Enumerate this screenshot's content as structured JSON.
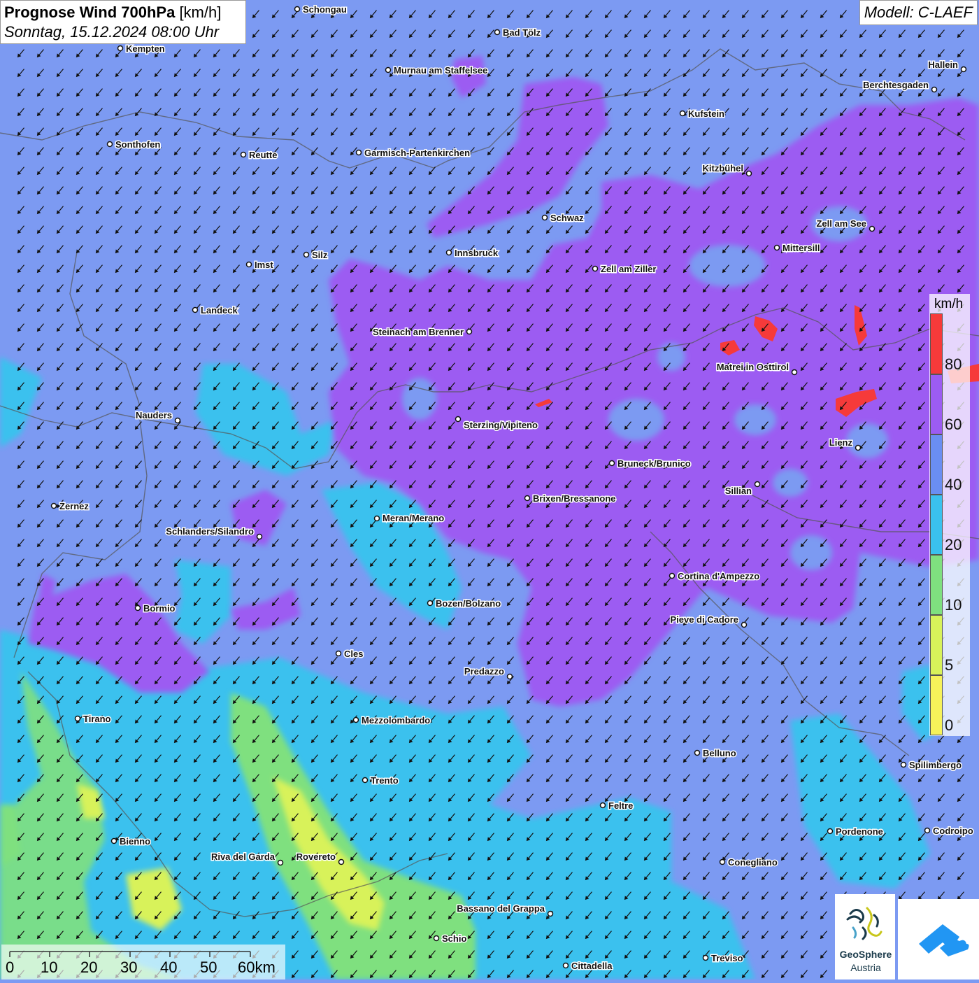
{
  "title": {
    "bold": "Prognose Wind 700hPa",
    "unit": "[km/h]",
    "date": "Sonntag, 15.12.2024 08:00 Uhr"
  },
  "model": "Modell: C-LAEF",
  "legend": {
    "unit": "km/h",
    "labels": [
      "80",
      "60",
      "40",
      "20",
      "10",
      "5",
      "0"
    ],
    "colors": {
      "80+": "#f63a3a",
      "60-80": "#9c5cf2",
      "40-60": "#6a8ef2",
      "20-40": "#3ac1ee",
      "10-20": "#7fe07f",
      "5-10": "#d8f25a",
      "0-5": "#f6f25a"
    }
  },
  "scale": {
    "labels": [
      "0",
      "10",
      "20",
      "30",
      "40",
      "50",
      "60km"
    ]
  },
  "logo": {
    "name": "GeoSphere",
    "sub": "Austria",
    "icon": "geosphere-logo-icon",
    "icon2": "cloud-arrow-icon"
  },
  "wind_direction": "north-west to south-east arrows",
  "cities": [
    {
      "name": "Schongau"
    },
    {
      "name": "Bad Tölz"
    },
    {
      "name": "Kempten"
    },
    {
      "name": "Murnau am Staffelsee"
    },
    {
      "name": "Hallein"
    },
    {
      "name": "Berchtesgaden"
    },
    {
      "name": "Kufstein"
    },
    {
      "name": "Sonthofen"
    },
    {
      "name": "Reutte"
    },
    {
      "name": "Garmisch-Partenkirchen"
    },
    {
      "name": "Kitzbühel"
    },
    {
      "name": "Schwaz"
    },
    {
      "name": "Zell am See"
    },
    {
      "name": "Innsbruck"
    },
    {
      "name": "Mittersill"
    },
    {
      "name": "Silz"
    },
    {
      "name": "Imst"
    },
    {
      "name": "Zell am Ziller"
    },
    {
      "name": "Landeck"
    },
    {
      "name": "Steinach am Brenner"
    },
    {
      "name": "Matrei in Osttirol"
    },
    {
      "name": "Nauders"
    },
    {
      "name": "Sterzing/Vipiteno"
    },
    {
      "name": "Lienz"
    },
    {
      "name": "Bruneck/Brunico"
    },
    {
      "name": "Sillian"
    },
    {
      "name": "Zernez"
    },
    {
      "name": "Brixen/Bressanone"
    },
    {
      "name": "Meran/Merano"
    },
    {
      "name": "Schlanders/Silandro"
    },
    {
      "name": "Cortina d'Ampezzo"
    },
    {
      "name": "Bormio"
    },
    {
      "name": "Bozen/Bolzano"
    },
    {
      "name": "Pieve di Cadore"
    },
    {
      "name": "Cles"
    },
    {
      "name": "Predazzo"
    },
    {
      "name": "Tirano"
    },
    {
      "name": "Mezzolombardo"
    },
    {
      "name": "Belluno"
    },
    {
      "name": "Spilimbergo"
    },
    {
      "name": "Trento"
    },
    {
      "name": "Feltre"
    },
    {
      "name": "Bienno"
    },
    {
      "name": "Pordenone"
    },
    {
      "name": "Codroipo"
    },
    {
      "name": "Riva del Garda"
    },
    {
      "name": "Rovereto"
    },
    {
      "name": "Conegliano"
    },
    {
      "name": "Bassano del Grappa"
    },
    {
      "name": "Schio"
    },
    {
      "name": "Treviso"
    },
    {
      "name": "Cittadella"
    }
  ]
}
